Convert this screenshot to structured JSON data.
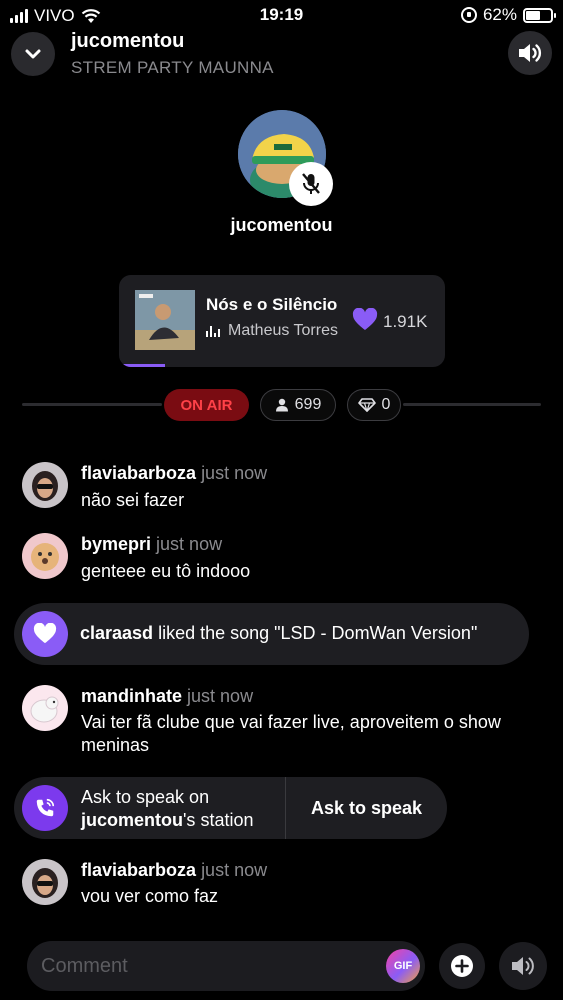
{
  "status_bar": {
    "carrier": "VIVO",
    "time": "19:19",
    "battery": "62%",
    "battery_level": 0.62
  },
  "header": {
    "title": "jucomentou",
    "subtitle": "STREM PARTY MAUNNA"
  },
  "host": {
    "name": "jucomentou"
  },
  "now_playing": {
    "title": "Nós e o Silêncio",
    "artist": "Matheus Torres",
    "likes": "1.91K",
    "progress": 0.14
  },
  "stats": {
    "on_air": "ON AIR",
    "listeners": "699",
    "gems": "0"
  },
  "feed": [
    {
      "user": "flaviabarboza",
      "time": "just now",
      "text": "não sei fazer"
    },
    {
      "user": "bymepri",
      "time": "just now",
      "text": "genteee eu tô indooo"
    },
    {
      "event_user": "claraasd",
      "event_text": "liked the song \"LSD - DomWan Version\""
    },
    {
      "user": "mandinhate",
      "time": "just now",
      "text": "Vai ter fã clube que vai fazer live, aproveitem o show meninas"
    },
    {
      "ask_line1": "Ask to speak on",
      "ask_station_owner": "jucomentou",
      "ask_suffix": "'s station",
      "ask_button": "Ask to speak"
    },
    {
      "user": "flaviabarboza",
      "time": "just now",
      "text": "vou ver como faz"
    }
  ],
  "composer": {
    "placeholder": "Comment",
    "gif_label": "GIF"
  }
}
